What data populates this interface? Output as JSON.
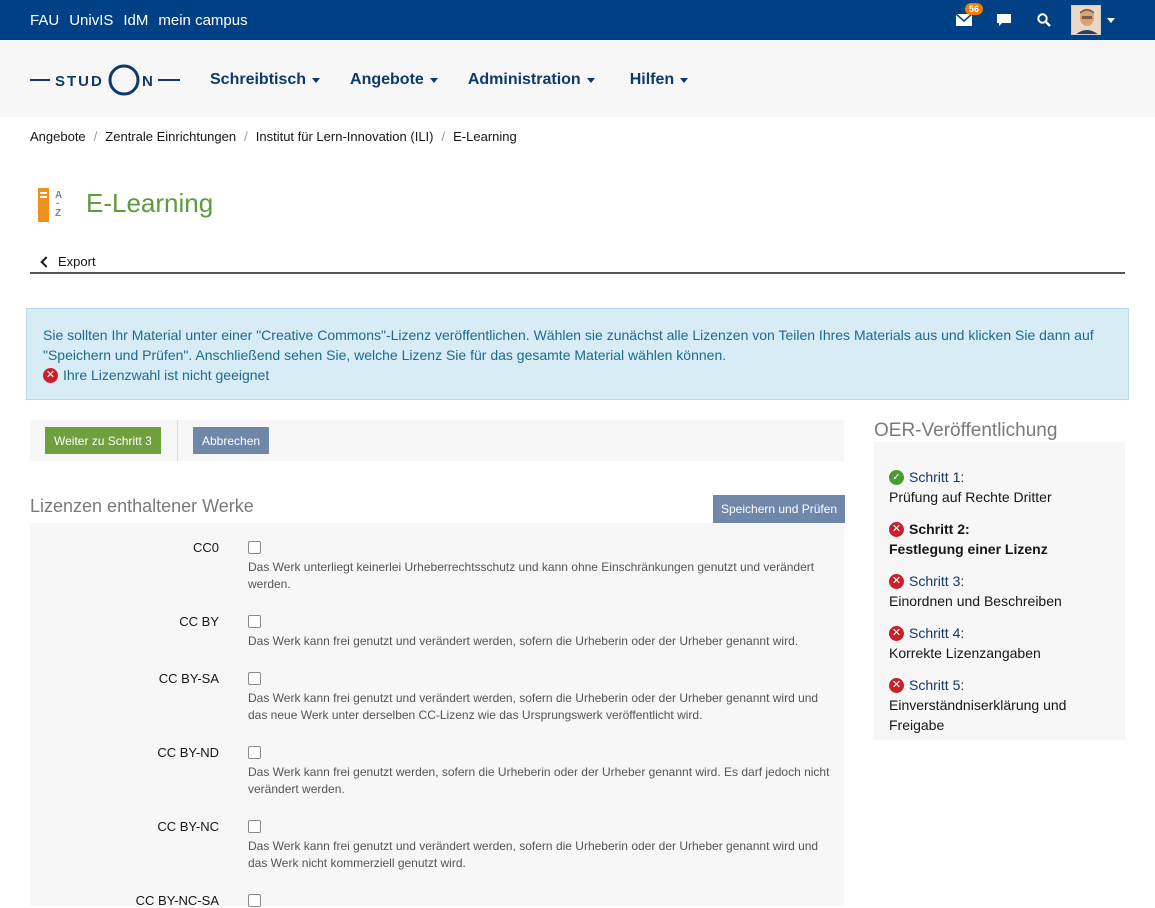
{
  "topbar": {
    "links": [
      "FAU",
      "UnivIS",
      "IdM",
      "mein campus"
    ],
    "mail_badge": "56",
    "icons": [
      "mail-icon",
      "chat-icon",
      "search-icon",
      "avatar"
    ]
  },
  "header": {
    "logo_text": "STUDON",
    "nav": [
      "Schreibtisch",
      "Angebote",
      "Administration",
      "Hilfen"
    ]
  },
  "breadcrumb": [
    "Angebote",
    "Zentrale Einrichtungen",
    "Institut für Lern-Innovation (ILI)",
    "E-Learning"
  ],
  "page": {
    "title": "E-Learning",
    "back_tab": "Export"
  },
  "info": {
    "message": "Sie sollten Ihr Material unter einer \"Creative Commons\"-Lizenz veröffentlichen. Wählen sie zunächst alle Lizenzen von Teilen Ihres Materials aus und klicken Sie dann auf \"Speichern und Prüfen\". Anschließend sehen Sie, welche Lizenz Sie für das gesamte Material wählen können.",
    "error": "Ihre Lizenzwahl ist nicht geeignet"
  },
  "toolbar": {
    "next_label": "Weiter zu Schritt 3",
    "cancel_label": "Abbrechen"
  },
  "licenses": {
    "section_title": "Lizenzen enthaltener Werke",
    "save_label": "Speichern und Prüfen",
    "items": [
      {
        "label": "CC0",
        "desc": "Das Werk unterliegt keinerlei Urheberrechtsschutz und kann ohne Einschränkungen genutzt und verändert werden.",
        "checked": false
      },
      {
        "label": "CC BY",
        "desc": "Das Werk kann frei genutzt und verändert werden, sofern die Urheberin oder der Urheber genannt wird.",
        "checked": false
      },
      {
        "label": "CC BY-SA",
        "desc": "Das Werk kann frei genutzt und verändert werden, sofern die Urheberin oder der Urheber genannt wird und das neue Werk unter derselben CC-Lizenz wie das Ursprungswerk veröffentlicht wird.",
        "checked": false
      },
      {
        "label": "CC BY-ND",
        "desc": "Das Werk kann frei genutzt werden, sofern die Urheberin oder der Urheber genannt wird. Es darf jedoch nicht verändert werden.",
        "checked": false
      },
      {
        "label": "CC BY-NC",
        "desc": "Das Werk kann frei genutzt und verändert werden, sofern die Urheberin oder der Urheber genannt wird und das Werk nicht kommerziell genutzt wird.",
        "checked": false
      },
      {
        "label": "CC BY-NC-SA",
        "desc": "",
        "checked": false
      }
    ]
  },
  "sidebar": {
    "title": "OER-Veröffentlichung",
    "steps": [
      {
        "head": "Schritt 1:",
        "sub": "Prüfung auf Rechte Dritter",
        "status": "ok"
      },
      {
        "head": "Schritt 2:",
        "sub": "Festlegung einer Lizenz",
        "status": "error",
        "active": true
      },
      {
        "head": "Schritt 3:",
        "sub": "Einordnen und Beschreiben",
        "status": "error"
      },
      {
        "head": "Schritt 4:",
        "sub": "Korrekte Lizenzangaben",
        "status": "error"
      },
      {
        "head": "Schritt 5:",
        "sub": "Einverständniserklärung und Freigabe",
        "status": "error"
      }
    ]
  },
  "colors": {
    "topbar": "#004186",
    "title_green": "#5d9b3b",
    "button_green": "#6ea13d",
    "button_grey": "#6f87a8",
    "info_bg": "#d8ecf5",
    "error_red": "#c9202a"
  }
}
